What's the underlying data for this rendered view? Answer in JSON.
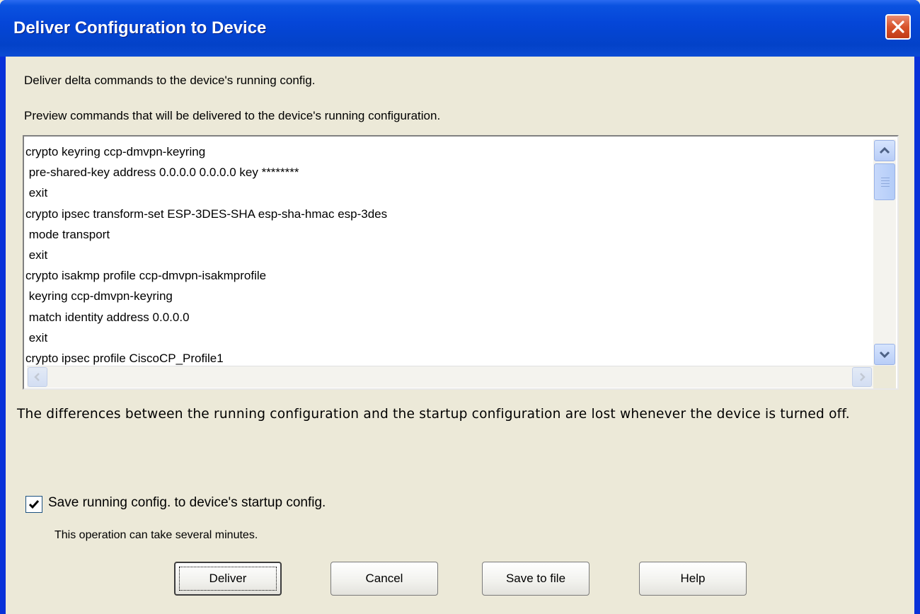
{
  "window": {
    "title": "Deliver Configuration to Device",
    "close_icon": "close-icon",
    "colors": {
      "titlebar": "#0546d8",
      "close": "#d8532b",
      "client": "#ece9d8"
    }
  },
  "intro_text": "Deliver delta commands to the device's running config.",
  "preview_label": "Preview commands that will be delivered to the device's running configuration.",
  "commands": [
    "crypto keyring ccp-dmvpn-keyring",
    " pre-shared-key address 0.0.0.0 0.0.0.0 key ********",
    " exit",
    "crypto ipsec transform-set ESP-3DES-SHA esp-sha-hmac esp-3des",
    " mode transport",
    " exit",
    "crypto isakmp profile ccp-dmvpn-isakmprofile",
    " keyring ccp-dmvpn-keyring",
    " match identity address 0.0.0.0",
    " exit",
    "crypto ipsec profile CiscoCP_Profile1"
  ],
  "warning_text": "The differences between the running configuration and the startup configuration are lost whenever the device is turned off.",
  "save_checkbox": {
    "label": "Save running config. to device's startup config.",
    "checked": true
  },
  "operation_note": "This operation can take several minutes.",
  "buttons": {
    "deliver": "Deliver",
    "cancel": "Cancel",
    "save_to_file": "Save to file",
    "help": "Help"
  }
}
